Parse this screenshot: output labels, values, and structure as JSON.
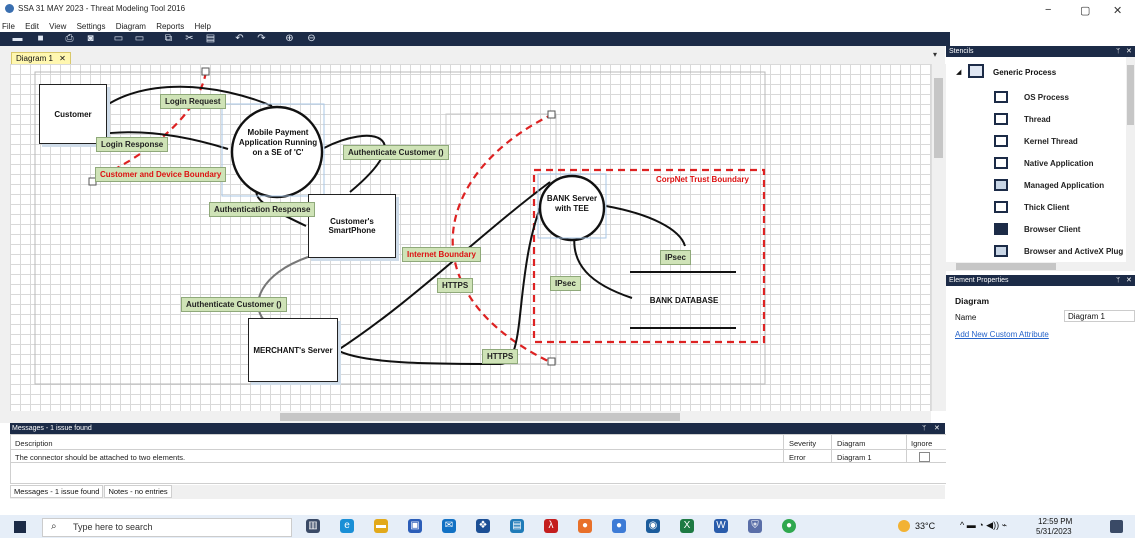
{
  "window": {
    "title": "SSA 31 MAY 2023 - Threat Modeling Tool 2016",
    "controls": [
      "−",
      "▢",
      "✕"
    ]
  },
  "menu": [
    "File",
    "Edit",
    "View",
    "Settings",
    "Diagram",
    "Reports",
    "Help"
  ],
  "toolbar_icons": [
    "open-icon",
    "save-icon",
    "print-icon",
    "report-icon",
    "new-diagram-icon",
    "copy-diagram-icon",
    "copy-icon",
    "cut-icon",
    "paste-icon",
    "undo-icon",
    "redo-icon",
    "zoom-in-icon",
    "zoom-out-icon"
  ],
  "tabs": [
    {
      "label": "Diagram 1",
      "close": "✕"
    }
  ],
  "diagram": {
    "customer": "Customer",
    "mobile_payment": "Mobile Payment Application Running on a SE of 'C'",
    "customer_phone": "Customer's SmartPhone",
    "merchant": "MERCHANT's Server",
    "bank_server": "BANK Server with TEE",
    "bank_db": "BANK DATABASE",
    "flows": {
      "login_request": "Login Request",
      "login_response": "Login Response",
      "authenticate_customer_1": "Authenticate Customer ()",
      "authentication_response": "Authentication Response",
      "authenticate_customer_2": "Authenticate Customer ()",
      "https_1": "HTTPS",
      "https_2": "HTTPS",
      "ipsec_1": "IPsec",
      "ipsec_2": "IPsec"
    },
    "boundaries": {
      "customer_device": "Customer and Device Boundary",
      "internet": "Internet Boundary",
      "corpnet": "CorpNet Trust Boundary"
    }
  },
  "messages": {
    "header": "Messages - 1 issue found",
    "columns": [
      "Description",
      "Severity",
      "Diagram",
      "Ignore"
    ],
    "rows": [
      {
        "description": "The connector should be attached to two elements.",
        "severity": "Error",
        "diagram": "Diagram 1"
      }
    ],
    "tabs": [
      "Messages - 1 issue found",
      "Notes - no entries"
    ]
  },
  "stencils": {
    "header": "Stencils",
    "group": "Generic Process",
    "items": [
      "OS Process",
      "Thread",
      "Kernel Thread",
      "Native Application",
      "Managed Application",
      "Thick Client",
      "Browser Client",
      "Browser and ActiveX Plug"
    ]
  },
  "element_properties": {
    "header": "Element Properties",
    "section": "Diagram",
    "name_label": "Name",
    "name_value": "Diagram 1",
    "add_link": "Add New Custom Attribute"
  },
  "taskbar": {
    "search_placeholder": "Type here to search",
    "weather": "33°C",
    "time": "12:59 PM",
    "date": "5/31/2023"
  },
  "colors": {
    "toolbar": "#1c2b47",
    "boundary_red": "#dd2222",
    "flow_label_bg": "#cfe3b7",
    "selection_blue": "#a9c7e6"
  }
}
